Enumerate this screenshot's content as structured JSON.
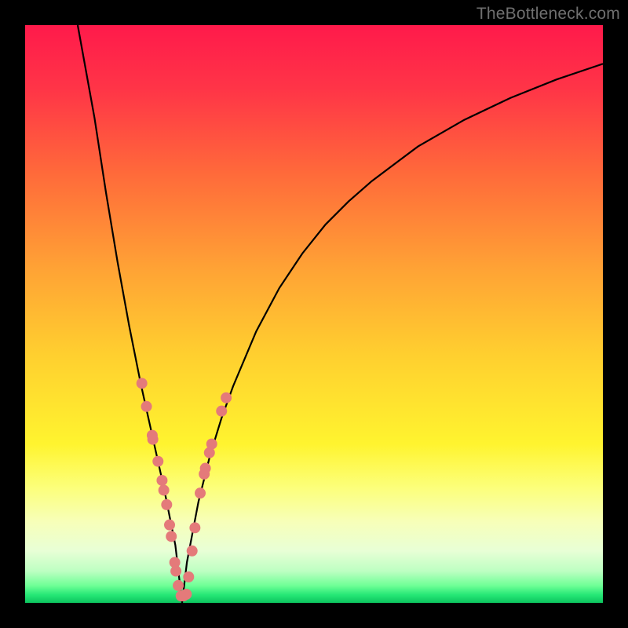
{
  "watermark": "TheBottleneck.com",
  "gradient_stops": [
    {
      "offset": 0.0,
      "color": "#ff1a4b"
    },
    {
      "offset": 0.112,
      "color": "#ff3547"
    },
    {
      "offset": 0.26,
      "color": "#ff6b3a"
    },
    {
      "offset": 0.42,
      "color": "#ffa235"
    },
    {
      "offset": 0.57,
      "color": "#ffcf2f"
    },
    {
      "offset": 0.725,
      "color": "#fff42f"
    },
    {
      "offset": 0.8,
      "color": "#fcff7a"
    },
    {
      "offset": 0.86,
      "color": "#f7ffb9"
    },
    {
      "offset": 0.91,
      "color": "#e8ffd6"
    },
    {
      "offset": 0.945,
      "color": "#bdffc2"
    },
    {
      "offset": 0.97,
      "color": "#6fff96"
    },
    {
      "offset": 0.986,
      "color": "#26e876"
    },
    {
      "offset": 1.0,
      "color": "#0cc45e"
    }
  ],
  "chart_data": {
    "type": "line",
    "title": "",
    "xlabel": "",
    "ylabel": "",
    "xlim": [
      0,
      100
    ],
    "ylim": [
      0,
      100
    ],
    "grid": false,
    "legend": false,
    "annotations": [
      {
        "text": "TheBottleneck.com",
        "position": "top-right"
      }
    ],
    "series": [
      {
        "name": "bottleneck-curve",
        "color": "#000000",
        "x": [
          9.1,
          12,
          14,
          16,
          18,
          20,
          22,
          24,
          26,
          27.17,
          28,
          30,
          32,
          34,
          36,
          40,
          44,
          48,
          52,
          56,
          60,
          68,
          76,
          84,
          92,
          100
        ],
        "y": [
          100,
          84,
          71,
          59,
          48,
          38,
          29,
          20,
          10,
          0,
          7,
          17.5,
          25.5,
          32,
          37.5,
          47,
          54.5,
          60.5,
          65.5,
          69.5,
          73,
          79,
          83.6,
          87.4,
          90.6,
          93.3
        ]
      }
    ],
    "scatter": {
      "name": "data-points",
      "color": "#e47a7a",
      "radius_pct": 0.95,
      "points": [
        {
          "x": 20.2,
          "y": 38.0
        },
        {
          "x": 21.0,
          "y": 34.0
        },
        {
          "x": 22.0,
          "y": 29.0
        },
        {
          "x": 22.1,
          "y": 28.3
        },
        {
          "x": 23.0,
          "y": 24.5
        },
        {
          "x": 23.7,
          "y": 21.2
        },
        {
          "x": 24.0,
          "y": 19.5
        },
        {
          "x": 24.5,
          "y": 17.0
        },
        {
          "x": 25.0,
          "y": 13.5
        },
        {
          "x": 25.3,
          "y": 11.5
        },
        {
          "x": 25.9,
          "y": 7.0
        },
        {
          "x": 26.1,
          "y": 5.5
        },
        {
          "x": 26.5,
          "y": 3.0
        },
        {
          "x": 27.0,
          "y": 1.2
        },
        {
          "x": 27.4,
          "y": 1.2
        },
        {
          "x": 27.9,
          "y": 1.5
        },
        {
          "x": 28.3,
          "y": 4.5
        },
        {
          "x": 28.9,
          "y": 9.0
        },
        {
          "x": 29.4,
          "y": 13.0
        },
        {
          "x": 30.3,
          "y": 19.0
        },
        {
          "x": 31.0,
          "y": 22.3
        },
        {
          "x": 31.2,
          "y": 23.3
        },
        {
          "x": 31.9,
          "y": 26.0
        },
        {
          "x": 32.3,
          "y": 27.5
        },
        {
          "x": 34.0,
          "y": 33.2
        },
        {
          "x": 34.8,
          "y": 35.5
        }
      ]
    }
  }
}
